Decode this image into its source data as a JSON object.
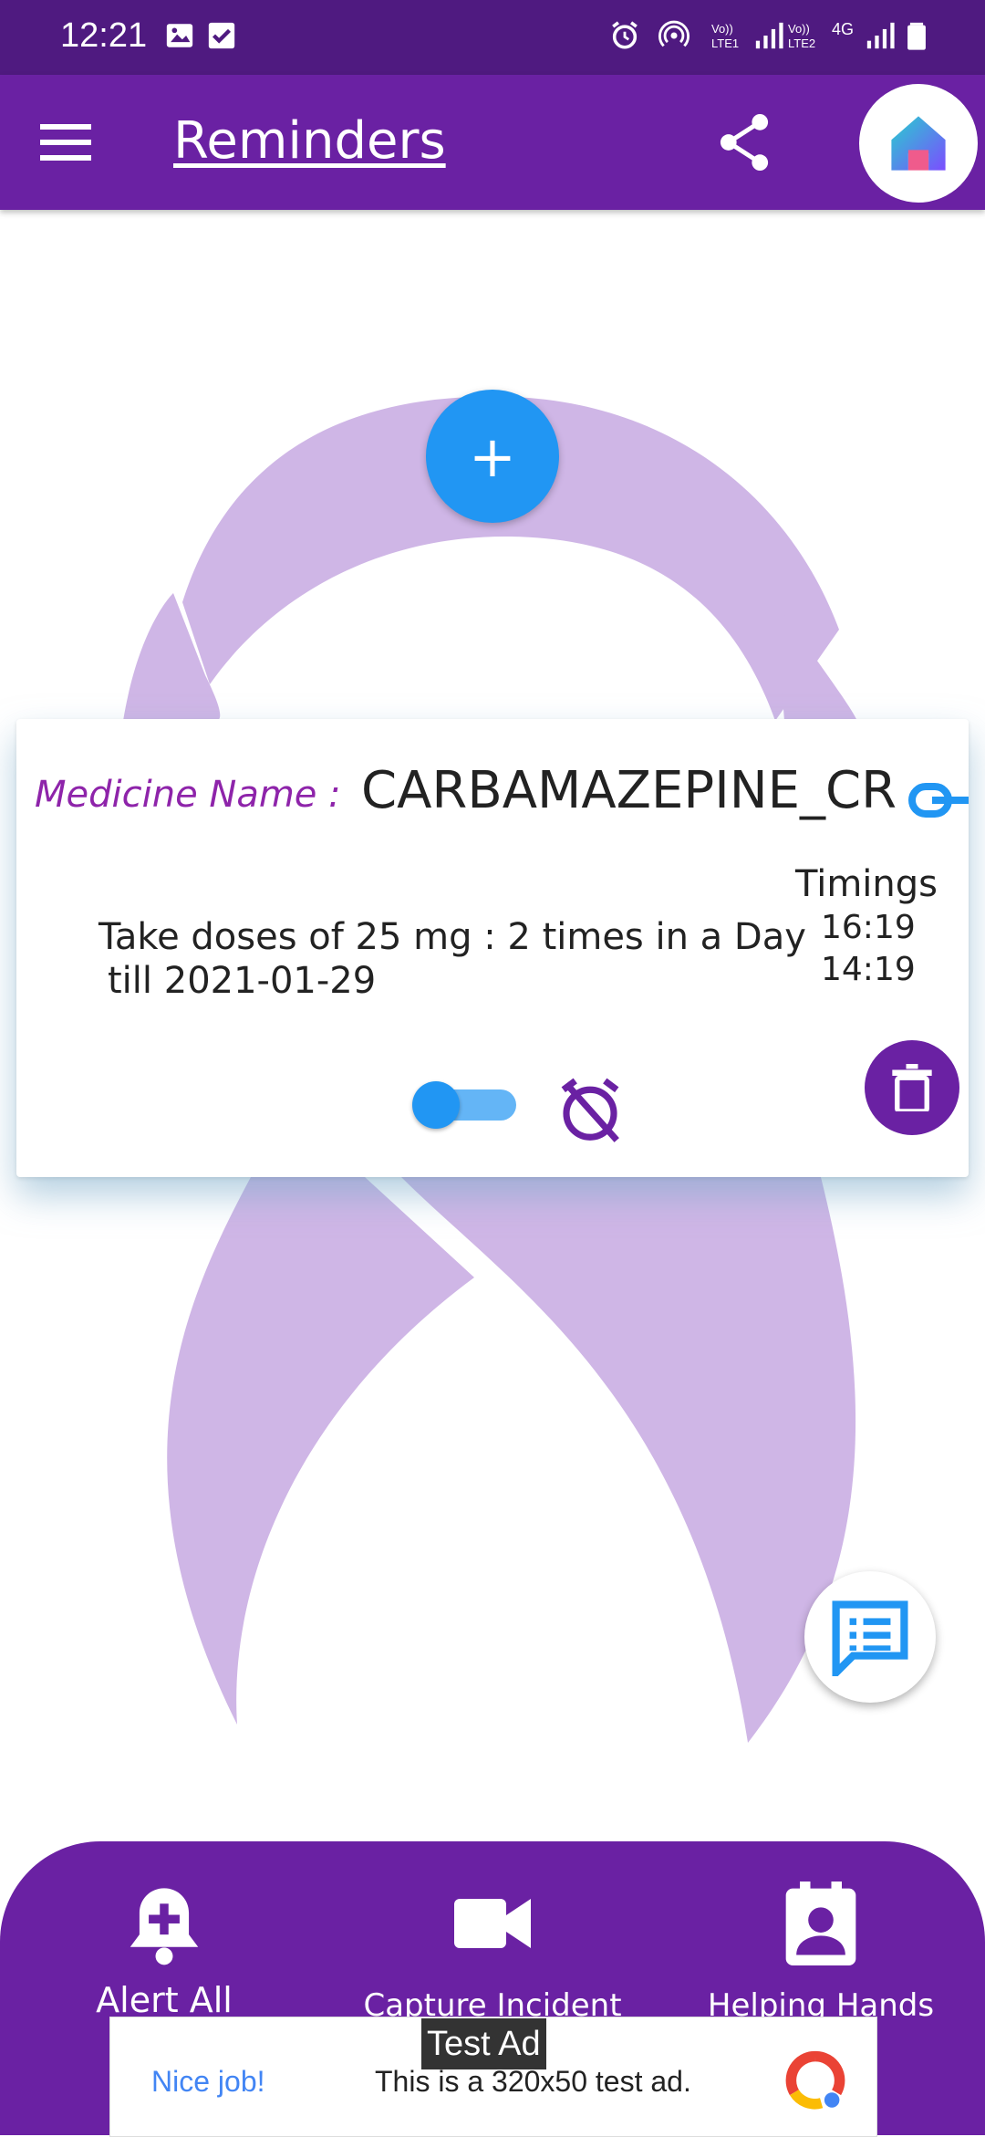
{
  "status_bar": {
    "time": "12:21",
    "sim1": "Vo)) LTE1",
    "sim2": "Vo)) LTE2",
    "network": "4G"
  },
  "app_bar": {
    "title": "Reminders",
    "menu_icon": "menu-icon",
    "share_icon": "share-icon",
    "home_icon": "home-icon"
  },
  "reminder_card": {
    "medicine_label": "Medicine Name :",
    "medicine_name": "CARBAMAZEPINE_CR",
    "dose_line1": "Take doses of 25 mg : 2 times in a Day",
    "dose_line2": "till 2021-01-29",
    "timings_label": "Timings",
    "timings": [
      "16:19",
      "14:19"
    ],
    "toggle_on": true
  },
  "bottom_nav": {
    "items": [
      {
        "label": "Alert All",
        "icon": "bell-plus-icon"
      },
      {
        "label": "Capture Incident",
        "icon": "video-camera-icon"
      },
      {
        "label": "Helping Hands",
        "icon": "contact-badge-icon"
      }
    ]
  },
  "ad": {
    "badge": "Test Ad",
    "headline": "Nice job!",
    "body": "This is a 320x50 test ad."
  },
  "colors": {
    "primary": "#6a21a3",
    "status_bar": "#4f1a80",
    "accent": "#2196f3",
    "ribbon": "#cfb6e6",
    "medicine_label": "#8e24aa"
  }
}
